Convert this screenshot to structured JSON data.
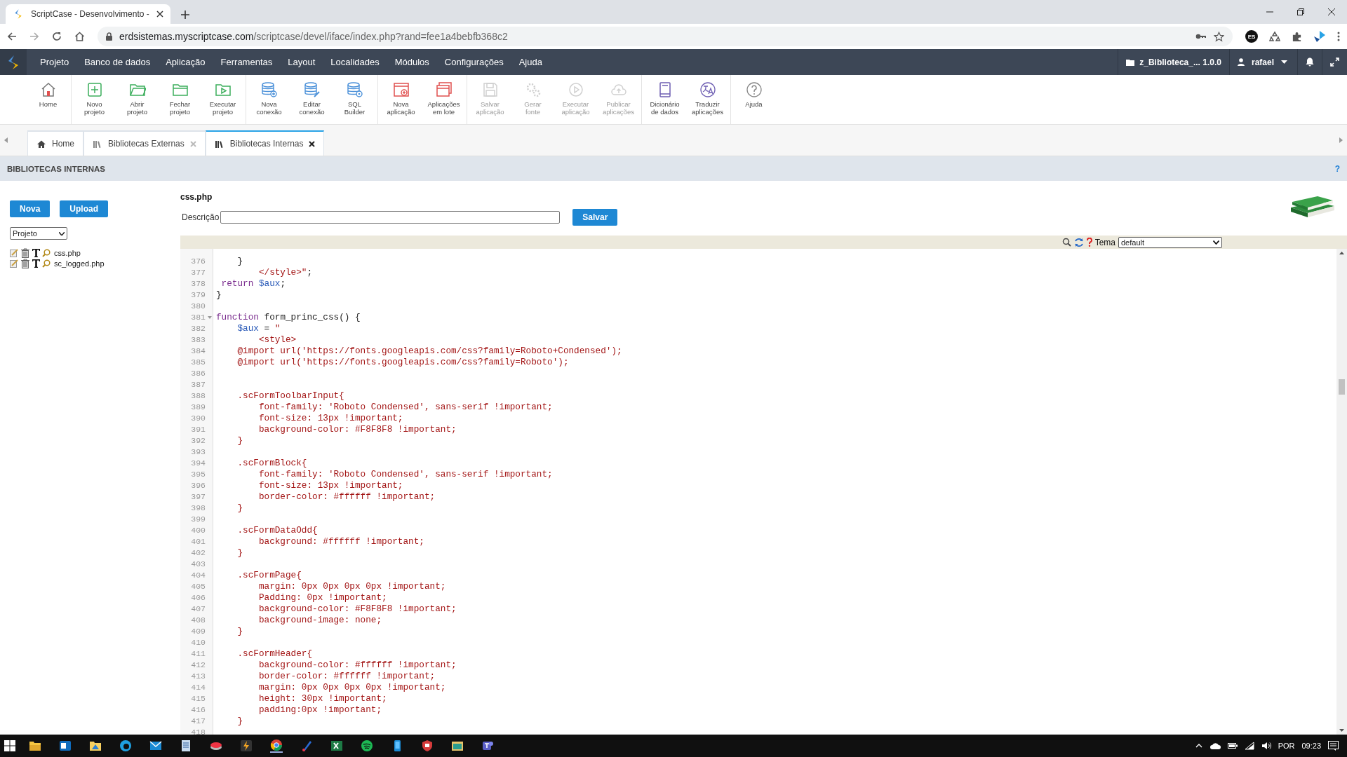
{
  "browser": {
    "tab_title": "ScriptCase - Desenvolvimento -",
    "url_host": "erdsistemas.myscriptcase.com",
    "url_path": "/scriptcase/devel/iface/index.php?rand=fee1a4bebfb368c2",
    "profile_badge": "ES"
  },
  "menu": {
    "items": [
      "Projeto",
      "Banco de dados",
      "Aplicação",
      "Ferramentas",
      "Layout",
      "Localidades",
      "Módulos",
      "Configurações",
      "Ajuda"
    ],
    "project": "z_Biblioteca_... 1.0.0",
    "user": "rafael"
  },
  "toolbar": {
    "groups": [
      [
        {
          "label": "Home",
          "disabled": false
        }
      ],
      [
        {
          "label": "Novo\nprojeto",
          "disabled": false
        },
        {
          "label": "Abrir\nprojeto",
          "disabled": false
        },
        {
          "label": "Fechar\nprojeto",
          "disabled": false
        },
        {
          "label": "Executar\nprojeto",
          "disabled": false
        }
      ],
      [
        {
          "label": "Nova\nconexão",
          "disabled": false
        },
        {
          "label": "Editar\nconexão",
          "disabled": false
        },
        {
          "label": "SQL\nBuilder",
          "disabled": false
        }
      ],
      [
        {
          "label": "Nova\naplicação",
          "disabled": false
        },
        {
          "label": "Aplicações\nem lote",
          "disabled": false
        }
      ],
      [
        {
          "label": "Salvar\naplicação",
          "disabled": true
        },
        {
          "label": "Gerar\nfonte",
          "disabled": true
        },
        {
          "label": "Executar\naplicação",
          "disabled": true
        },
        {
          "label": "Publicar\naplicações",
          "disabled": true
        }
      ],
      [
        {
          "label": "Dicionário\nde dados",
          "disabled": false
        },
        {
          "label": "Traduzir\naplicações",
          "disabled": false
        }
      ],
      [
        {
          "label": "Ajuda",
          "disabled": false
        }
      ]
    ]
  },
  "tabs": [
    {
      "label": "Home",
      "selected": false,
      "closable": false
    },
    {
      "label": "Bibliotecas Externas",
      "selected": false,
      "closable": true
    },
    {
      "label": "Bibliotecas Internas",
      "selected": true,
      "closable": true
    }
  ],
  "section": {
    "title": "BIBLIOTECAS INTERNAS",
    "help": "?"
  },
  "sidebar": {
    "buttons": [
      "Nova",
      "Upload"
    ],
    "scope_select": "Projeto",
    "files": [
      "css.php",
      "sc_logged.php"
    ]
  },
  "editor": {
    "file_name": "css.php",
    "description_label": "Descrição",
    "save_button": "Salvar",
    "theme_label": "Tema",
    "theme": "default",
    "lines": [
      {
        "number": "376",
        "fold": false,
        "tokens": [
          {
            "kind": "plain",
            "text": "    }"
          }
        ]
      },
      {
        "number": "377",
        "fold": false,
        "tokens": [
          {
            "kind": "string",
            "text": "        </style>\""
          },
          {
            "kind": "plain",
            "text": ";"
          }
        ]
      },
      {
        "number": "378",
        "fold": false,
        "tokens": [
          {
            "kind": "keyword",
            "text": " return"
          },
          {
            "kind": "variable",
            "text": " $aux"
          },
          {
            "kind": "plain",
            "text": ";"
          }
        ]
      },
      {
        "number": "379",
        "fold": false,
        "tokens": [
          {
            "kind": "plain",
            "text": "}"
          }
        ]
      },
      {
        "number": "380",
        "fold": false
      },
      {
        "number": "381",
        "fold": true,
        "tokens": [
          {
            "kind": "keyword",
            "text": "function"
          },
          {
            "kind": "plain",
            "text": " form_princ_css() {"
          }
        ]
      },
      {
        "number": "382",
        "fold": false,
        "tokens": [
          {
            "kind": "variable",
            "text": "    $aux"
          },
          {
            "kind": "plain",
            "text": " = "
          },
          {
            "kind": "string",
            "text": "\""
          }
        ]
      },
      {
        "number": "383",
        "fold": false,
        "tokens": [
          {
            "kind": "string",
            "text": "        <style>"
          }
        ]
      },
      {
        "number": "384",
        "fold": false,
        "tokens": [
          {
            "kind": "string",
            "text": "    @import url('https://fonts.googleapis.com/css?family=Roboto+Condensed');"
          }
        ]
      },
      {
        "number": "385",
        "fold": false,
        "tokens": [
          {
            "kind": "string",
            "text": "    @import url('https://fonts.googleapis.com/css?family=Roboto');"
          }
        ]
      },
      {
        "number": "386",
        "fold": false
      },
      {
        "number": "387",
        "fold": false
      },
      {
        "number": "388",
        "fold": false,
        "tokens": [
          {
            "kind": "string",
            "text": "    .scFormToolbarInput{"
          }
        ]
      },
      {
        "number": "389",
        "fold": false,
        "tokens": [
          {
            "kind": "string",
            "text": "        font-family: 'Roboto Condensed', sans-serif !important;"
          }
        ]
      },
      {
        "number": "390",
        "fold": false,
        "tokens": [
          {
            "kind": "string",
            "text": "        font-size: 13px !important;"
          }
        ]
      },
      {
        "number": "391",
        "fold": false,
        "tokens": [
          {
            "kind": "string",
            "text": "        background-color: #F8F8F8 !important;"
          }
        ]
      },
      {
        "number": "392",
        "fold": false,
        "tokens": [
          {
            "kind": "string",
            "text": "    }"
          }
        ]
      },
      {
        "number": "393",
        "fold": false
      },
      {
        "number": "394",
        "fold": false,
        "tokens": [
          {
            "kind": "string",
            "text": "    .scFormBlock{"
          }
        ]
      },
      {
        "number": "395",
        "fold": false,
        "tokens": [
          {
            "kind": "string",
            "text": "        font-family: 'Roboto Condensed', sans-serif !important;"
          }
        ]
      },
      {
        "number": "396",
        "fold": false,
        "tokens": [
          {
            "kind": "string",
            "text": "        font-size: 13px !important;"
          }
        ]
      },
      {
        "number": "397",
        "fold": false,
        "tokens": [
          {
            "kind": "string",
            "text": "        border-color: #ffffff !important;"
          }
        ]
      },
      {
        "number": "398",
        "fold": false,
        "tokens": [
          {
            "kind": "string",
            "text": "    }"
          }
        ]
      },
      {
        "number": "399",
        "fold": false
      },
      {
        "number": "400",
        "fold": false,
        "tokens": [
          {
            "kind": "string",
            "text": "    .scFormDataOdd{"
          }
        ]
      },
      {
        "number": "401",
        "fold": false,
        "tokens": [
          {
            "kind": "string",
            "text": "        background: #ffffff !important;"
          }
        ]
      },
      {
        "number": "402",
        "fold": false,
        "tokens": [
          {
            "kind": "string",
            "text": "    }"
          }
        ]
      },
      {
        "number": "403",
        "fold": false
      },
      {
        "number": "404",
        "fold": false,
        "tokens": [
          {
            "kind": "string",
            "text": "    .scFormPage{"
          }
        ]
      },
      {
        "number": "405",
        "fold": false,
        "tokens": [
          {
            "kind": "string",
            "text": "        margin: 0px 0px 0px 0px !important;"
          }
        ]
      },
      {
        "number": "406",
        "fold": false,
        "tokens": [
          {
            "kind": "string",
            "text": "        Padding: 0px !important;"
          }
        ]
      },
      {
        "number": "407",
        "fold": false,
        "tokens": [
          {
            "kind": "string",
            "text": "        background-color: #F8F8F8 !important;"
          }
        ]
      },
      {
        "number": "408",
        "fold": false,
        "tokens": [
          {
            "kind": "string",
            "text": "        background-image: none;"
          }
        ]
      },
      {
        "number": "409",
        "fold": false,
        "tokens": [
          {
            "kind": "string",
            "text": "    }"
          }
        ]
      },
      {
        "number": "410",
        "fold": false
      },
      {
        "number": "411",
        "fold": false,
        "tokens": [
          {
            "kind": "string",
            "text": "    .scFormHeader{"
          }
        ]
      },
      {
        "number": "412",
        "fold": false,
        "tokens": [
          {
            "kind": "string",
            "text": "        background-color: #ffffff !important;"
          }
        ]
      },
      {
        "number": "413",
        "fold": false,
        "tokens": [
          {
            "kind": "string",
            "text": "        border-color: #ffffff !important;"
          }
        ]
      },
      {
        "number": "414",
        "fold": false,
        "tokens": [
          {
            "kind": "string",
            "text": "        margin: 0px 0px 0px 0px !important;"
          }
        ]
      },
      {
        "number": "415",
        "fold": false,
        "tokens": [
          {
            "kind": "string",
            "text": "        height: 30px !important;"
          }
        ]
      },
      {
        "number": "416",
        "fold": false,
        "tokens": [
          {
            "kind": "string",
            "text": "        padding:0px !important;"
          }
        ]
      },
      {
        "number": "417",
        "fold": false,
        "tokens": [
          {
            "kind": "string",
            "text": "    }"
          }
        ]
      },
      {
        "number": "418",
        "fold": false
      }
    ]
  },
  "taskbar": {
    "language": "POR",
    "time": "09:23"
  }
}
